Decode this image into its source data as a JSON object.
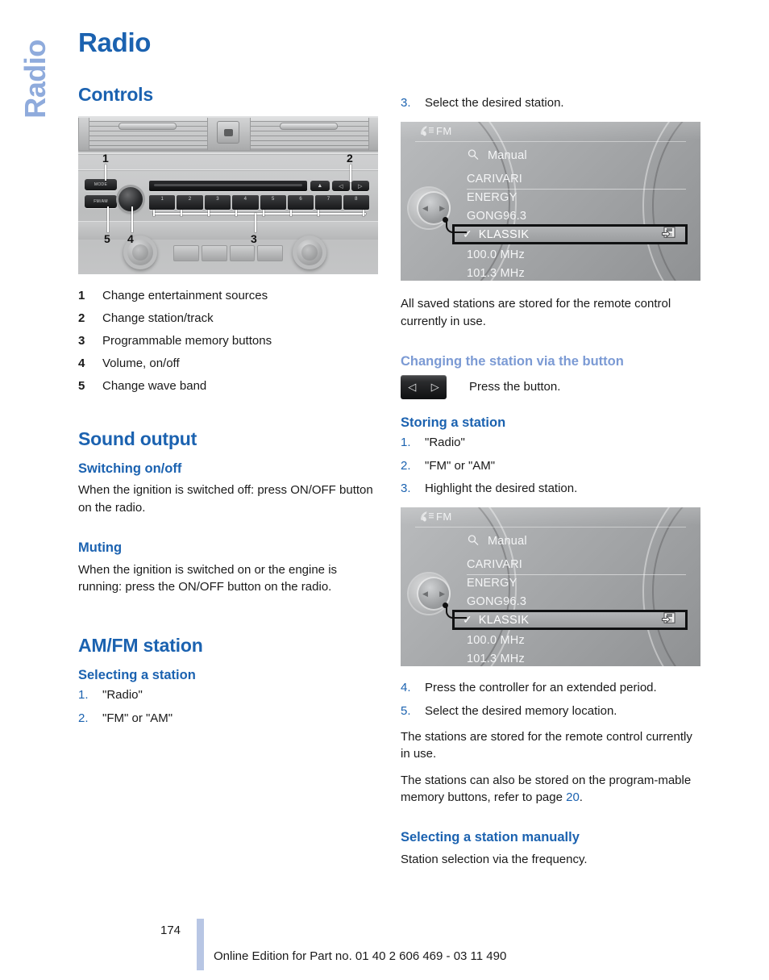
{
  "side_tab": {
    "label": "Radio"
  },
  "chapter_title": "Radio",
  "left_column": {
    "controls_heading": "Controls",
    "legend": [
      {
        "num": "1",
        "text": "Change entertainment sources"
      },
      {
        "num": "2",
        "text": "Change station/track"
      },
      {
        "num": "3",
        "text": "Programmable memory buttons"
      },
      {
        "num": "4",
        "text": "Volume, on/off"
      },
      {
        "num": "5",
        "text": "Change wave band"
      }
    ],
    "radio_photo": {
      "callouts": [
        "1",
        "2",
        "3",
        "4",
        "5"
      ],
      "mode_button": "MODE",
      "band_button": "FM/AM",
      "preset_labels": [
        "1",
        "2",
        "3",
        "4",
        "5",
        "6",
        "7",
        "8"
      ],
      "eject_label": "▲",
      "prev_label": "◁",
      "next_label": "▷"
    },
    "sound_output_heading": "Sound output",
    "switching_heading": "Switching on/off",
    "switching_body": "When the ignition is switched off: press ON/OFF button on the radio.",
    "muting_heading": "Muting",
    "muting_body": "When the ignition is switched on or the engine is running: press the ON/OFF button on the radio.",
    "amfm_heading": "AM/FM station",
    "selecting_heading": "Selecting a station",
    "selecting_steps": [
      {
        "num": "1.",
        "text": "\"Radio\""
      },
      {
        "num": "2.",
        "text": "\"FM\" or \"AM\""
      }
    ]
  },
  "right_column": {
    "step3_top": {
      "num": "3.",
      "text": "Select the desired station."
    },
    "screen": {
      "band_label": "FM",
      "antenna_icon": "antenna-icon",
      "manual_label": "Manual",
      "search_icon": "magnifier-icon",
      "stations": [
        "CARIVARI",
        "ENERGY",
        "GONG96.3"
      ],
      "selected_station": "KLASSIK",
      "selected_check": "✓",
      "save_icon": "save-icon",
      "frequencies": [
        "100.0  MHz",
        "101.3  MHz"
      ]
    },
    "saved_note": "All saved stations are stored for the remote control currently in use.",
    "changing_heading": "Changing the station via the button",
    "press_button_text": "Press the button.",
    "button_glyphs": {
      "left": "◁",
      "right": "▷"
    },
    "storing_heading": "Storing a station",
    "storing_steps_top": [
      {
        "num": "1.",
        "text": "\"Radio\""
      },
      {
        "num": "2.",
        "text": "\"FM\" or \"AM\""
      },
      {
        "num": "3.",
        "text": "Highlight the desired station."
      }
    ],
    "storing_steps_bottom": [
      {
        "num": "4.",
        "text": "Press the controller for an extended period."
      },
      {
        "num": "5.",
        "text": "Select the desired memory location."
      }
    ],
    "stored_note": "The stations are stored for the remote control currently in use.",
    "programmable_note_a": "The stations can also be stored on the program-",
    "programmable_note_b": "mable memory buttons, refer to page ",
    "programmable_page": "20",
    "programmable_note_c": ".",
    "manual_heading": "Selecting a station manually",
    "manual_body": "Station selection via the frequency."
  },
  "footer": {
    "page_number": "174",
    "note": "Online Edition for Part no. 01 40 2 606 469 - 03 11 490"
  },
  "colors": {
    "heading_blue": "#1b62b0",
    "light_blue": "#7b9ad4",
    "side_tab_blue": "#8fabdc",
    "footer_bar": "#b8c6e4",
    "body_text": "#1a1a1a"
  }
}
